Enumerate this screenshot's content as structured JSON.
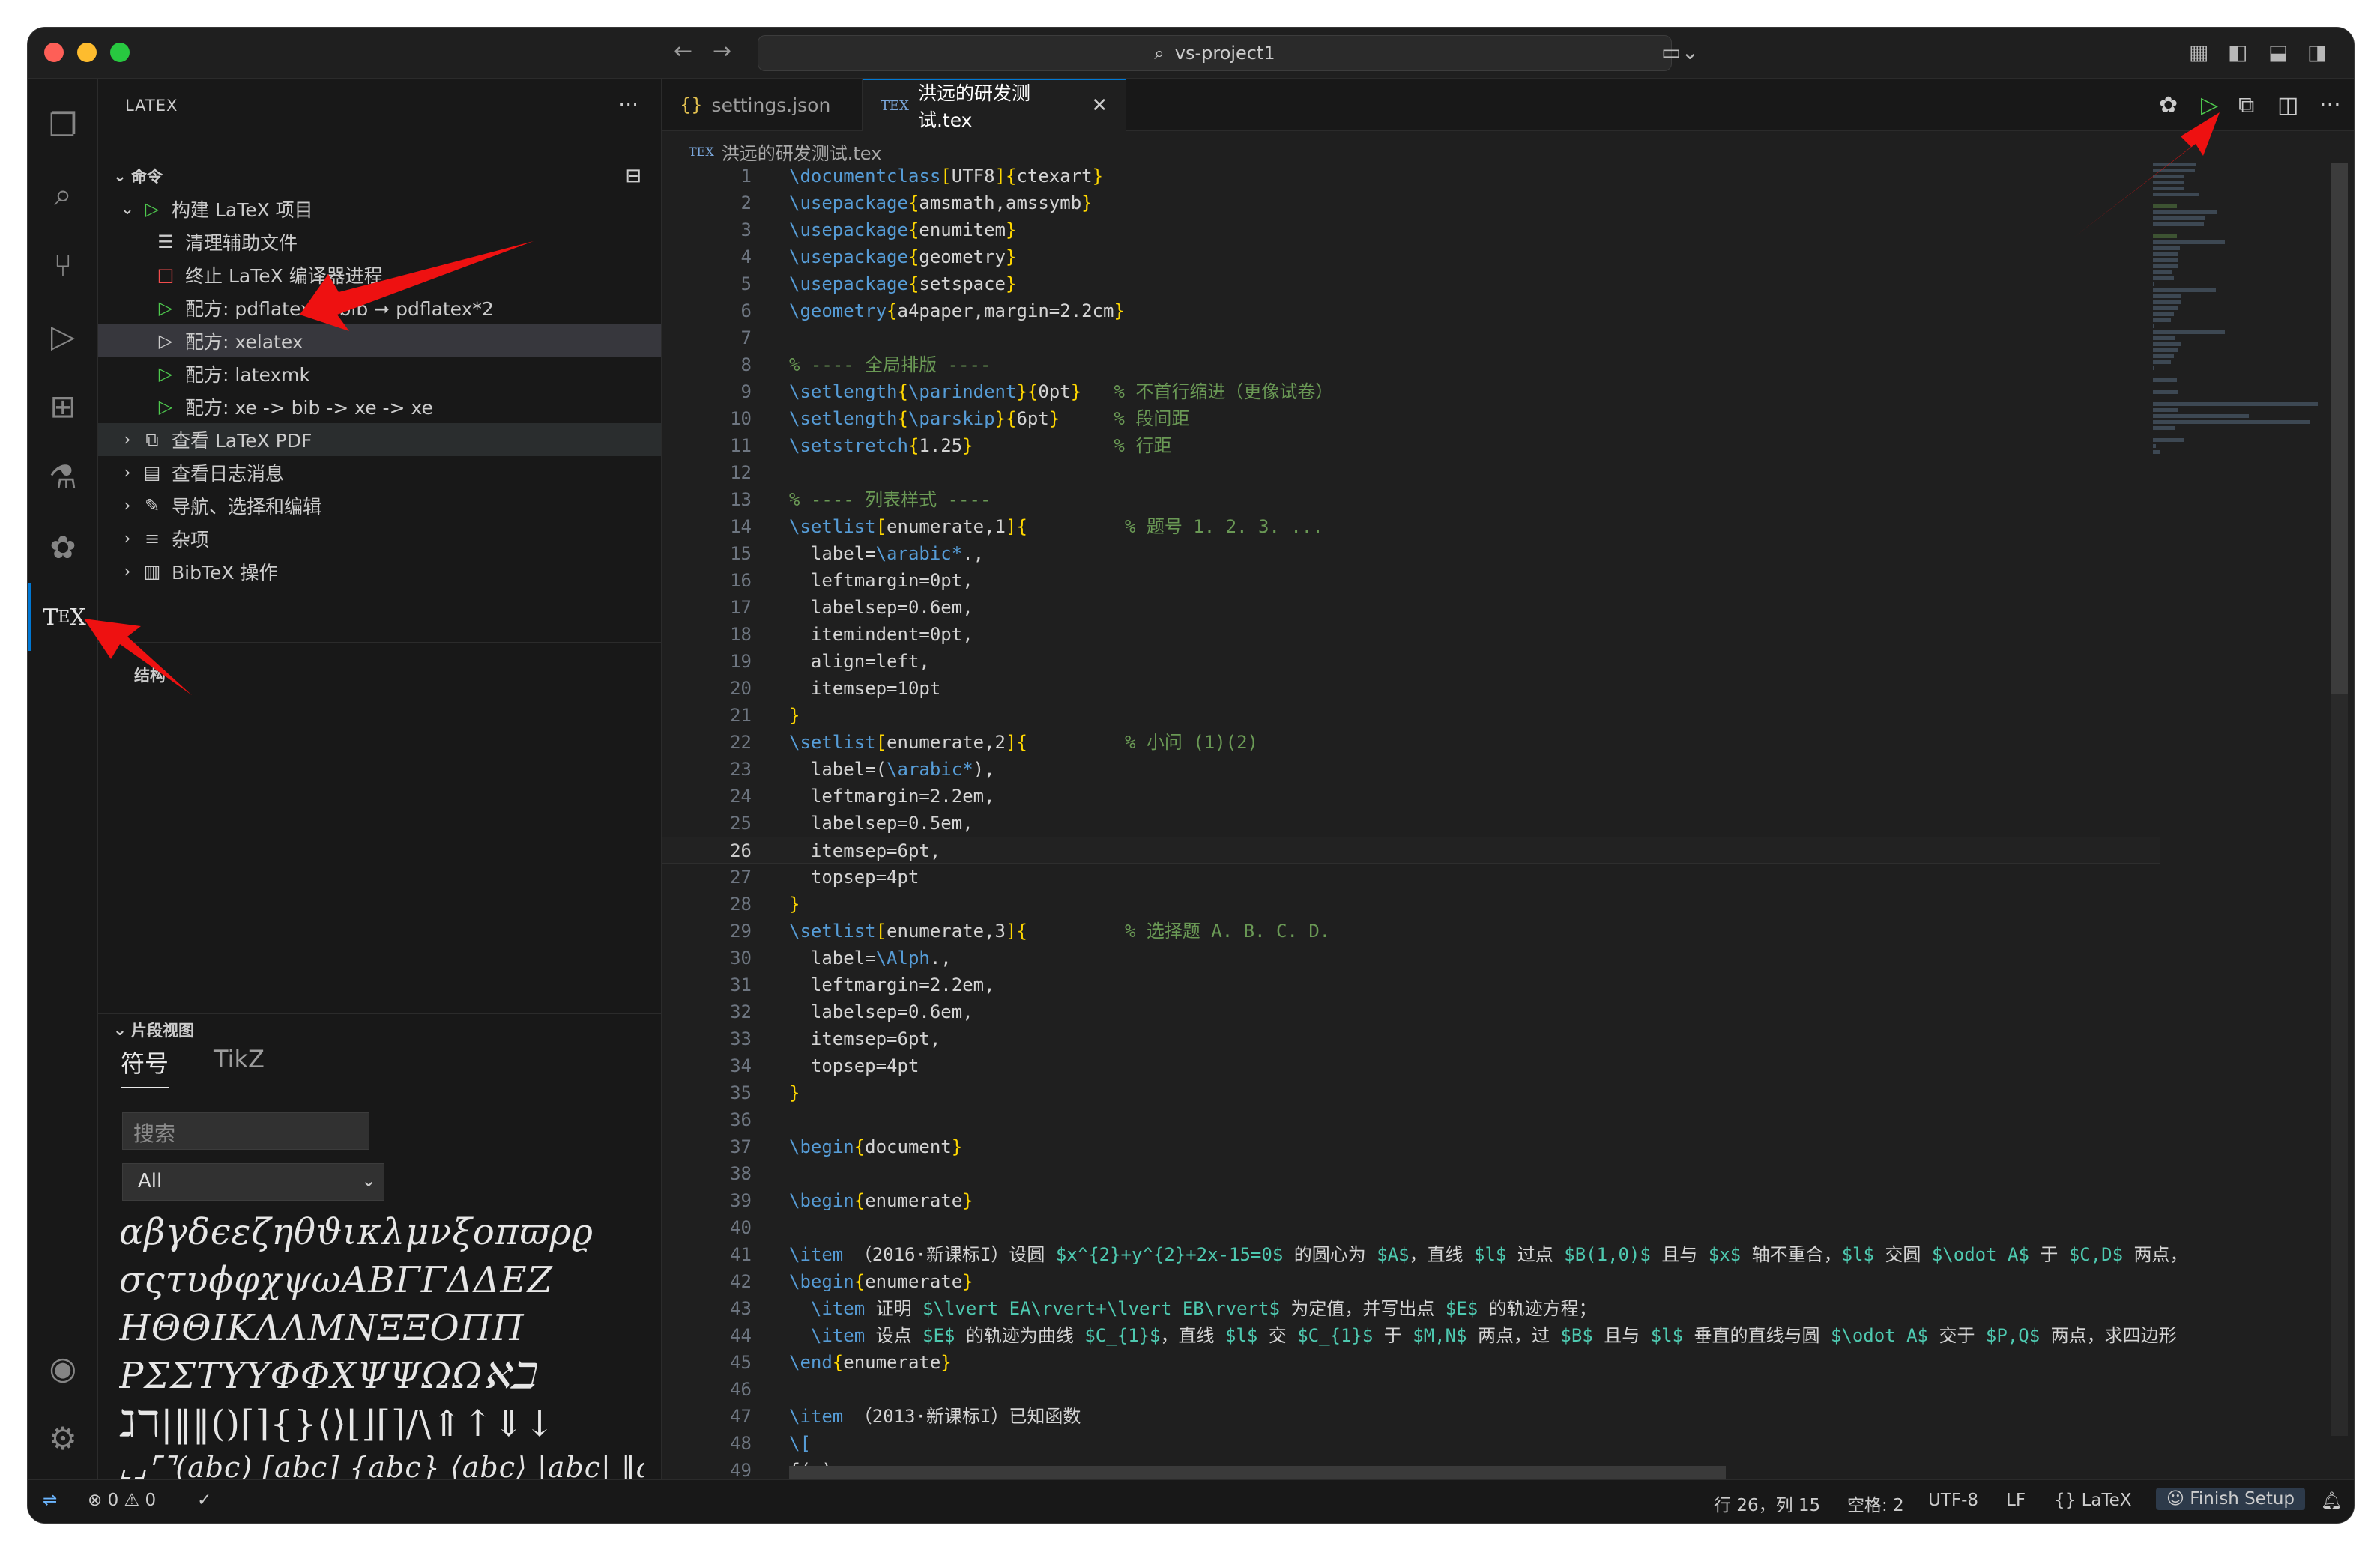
{
  "window": {
    "search_text": "vs-project1"
  },
  "sidebar": {
    "title": "LATEX",
    "commands_header": "命令",
    "build_item": "构建 LaTeX 项目",
    "children": [
      {
        "label": "清理辅助文件",
        "icon": "clean-icon"
      },
      {
        "label": "终止 LaTeX 编译器进程",
        "icon": "stop-icon"
      },
      {
        "label": "配方: pdflatex ➞ bib ➞ pdflatex*2",
        "icon": "play-icon"
      },
      {
        "label": "配方: xelatex",
        "icon": "play-icon"
      },
      {
        "label": "配方: latexmk",
        "icon": "play-icon"
      },
      {
        "label": "配方: xe -> bib -> xe -> xe",
        "icon": "play-icon"
      }
    ],
    "groups": [
      {
        "label": "查看 LaTeX PDF",
        "icon": "pdf-view-icon"
      },
      {
        "label": "查看日志消息",
        "icon": "log-icon"
      },
      {
        "label": "导航、选择和编辑",
        "icon": "pencil-icon"
      },
      {
        "label": "杂项",
        "icon": "list-icon"
      },
      {
        "label": "BibTeX 操作",
        "icon": "bibtex-icon"
      }
    ],
    "structure_header": "结构",
    "snippet_header": "片段视图",
    "snippet_tabs": [
      "符号",
      "TikZ"
    ],
    "search_placeholder": "搜索",
    "filter_value": "All",
    "symbol_rows": [
      "αβγδϵεζηθϑικλμνξoπϖρϱ",
      "σςτυϕφχψωΑΒΓΓΔΔΕΖ",
      "ΗΘΘΙΚΛΛΜΝΞΞΟΠΠ",
      "ΡΣΣΤΥΥΦΦΧΨΨΩΩℵℶ",
      "ℷℸ|‖‖()⌈⌉{}⟨⟩⌊⌋⌈⌉/\\⇑↑⇓↓",
      "⌞⌟⌜⌝(abc) [abc] {abc} ⟨abc⟩ |abc| ‖abc‖"
    ]
  },
  "editor": {
    "tabs": [
      {
        "label": "settings.json",
        "icon": "json-icon"
      },
      {
        "label": "洪远的研发测试.tex",
        "icon": "tex-icon"
      }
    ],
    "breadcrumb": "洪远的研发测试.tex",
    "current_line": 26,
    "lines": [
      {
        "n": "1",
        "code": "\\documentclass[UTF8]{ctexart}"
      },
      {
        "n": "2",
        "code": "\\usepackage{amsmath,amssymb}"
      },
      {
        "n": "3",
        "code": "\\usepackage{enumitem}"
      },
      {
        "n": "4",
        "code": "\\usepackage{geometry}"
      },
      {
        "n": "5",
        "code": "\\usepackage{setspace}"
      },
      {
        "n": "6",
        "code": "\\geometry{a4paper,margin=2.2cm}"
      },
      {
        "n": "7",
        "code": ""
      },
      {
        "n": "8",
        "code": "% ---- 全局排版 ----"
      },
      {
        "n": "9",
        "code": "\\setlength{\\parindent}{0pt}   % 不首行缩进（更像试卷）"
      },
      {
        "n": "10",
        "code": "\\setlength{\\parskip}{6pt}     % 段间距"
      },
      {
        "n": "11",
        "code": "\\setstretch{1.25}             % 行距"
      },
      {
        "n": "12",
        "code": ""
      },
      {
        "n": "13",
        "code": "% ---- 列表样式 ----"
      },
      {
        "n": "14",
        "code": "\\setlist[enumerate,1]{         % 题号 1. 2. 3. ..."
      },
      {
        "n": "15",
        "code": "  label=\\arabic*.,"
      },
      {
        "n": "16",
        "code": "  leftmargin=0pt,"
      },
      {
        "n": "17",
        "code": "  labelsep=0.6em,"
      },
      {
        "n": "18",
        "code": "  itemindent=0pt,"
      },
      {
        "n": "19",
        "code": "  align=left,"
      },
      {
        "n": "20",
        "code": "  itemsep=10pt"
      },
      {
        "n": "21",
        "code": "}"
      },
      {
        "n": "22",
        "code": "\\setlist[enumerate,2]{         % 小问 (1)(2)"
      },
      {
        "n": "23",
        "code": "  label=(\\arabic*),"
      },
      {
        "n": "24",
        "code": "  leftmargin=2.2em,"
      },
      {
        "n": "25",
        "code": "  labelsep=0.5em,"
      },
      {
        "n": "26",
        "code": "  itemsep=6pt,"
      },
      {
        "n": "27",
        "code": "  topsep=4pt"
      },
      {
        "n": "28",
        "code": "}"
      },
      {
        "n": "29",
        "code": "\\setlist[enumerate,3]{         % 选择题 A. B. C. D."
      },
      {
        "n": "30",
        "code": "  label=\\Alph.,"
      },
      {
        "n": "31",
        "code": "  leftmargin=2.2em,"
      },
      {
        "n": "32",
        "code": "  labelsep=0.6em,"
      },
      {
        "n": "33",
        "code": "  itemsep=6pt,"
      },
      {
        "n": "34",
        "code": "  topsep=4pt"
      },
      {
        "n": "35",
        "code": "}"
      },
      {
        "n": "36",
        "code": ""
      },
      {
        "n": "37",
        "code": "\\begin{document}"
      },
      {
        "n": "38",
        "code": ""
      },
      {
        "n": "39",
        "code": "\\begin{enumerate}"
      },
      {
        "n": "40",
        "code": ""
      },
      {
        "n": "41",
        "code": "\\item （2016·新课标I）设圆 $x^{2}+y^{2}+2x-15=0$ 的圆心为 $A$，直线 $l$ 过点 $B(1,0)$ 且与 $x$ 轴不重合，$l$ 交圆 $\\odot A$ 于 $C,D$ 两点，"
      },
      {
        "n": "42",
        "code": "\\begin{enumerate}"
      },
      {
        "n": "43",
        "code": "  \\item 证明 $\\lvert EA\\rvert+\\lvert EB\\rvert$ 为定值，并写出点 $E$ 的轨迹方程；"
      },
      {
        "n": "44",
        "code": "  \\item 设点 $E$ 的轨迹为曲线 $C_{1}$，直线 $l$ 交 $C_{1}$ 于 $M,N$ 两点，过 $B$ 且与 $l$ 垂直的直线与圆 $\\odot A$ 交于 $P,Q$ 两点，求四边形"
      },
      {
        "n": "45",
        "code": "\\end{enumerate}"
      },
      {
        "n": "46",
        "code": ""
      },
      {
        "n": "47",
        "code": "\\item （2013·新课标I）已知函数"
      },
      {
        "n": "48",
        "code": "\\["
      },
      {
        "n": "49",
        "code": "f(x)="
      }
    ]
  },
  "statusbar": {
    "errors": "0",
    "warnings": "0",
    "position": "行 26，列 15",
    "spaces": "空格: 2",
    "encoding": "UTF-8",
    "eol": "LF",
    "language": "LaTeX",
    "finish_setup": "Finish Setup"
  },
  "colors": {
    "accent": "#0078d4",
    "annotation_arrow": "#ee1111",
    "play_green": "#4ec94e"
  }
}
